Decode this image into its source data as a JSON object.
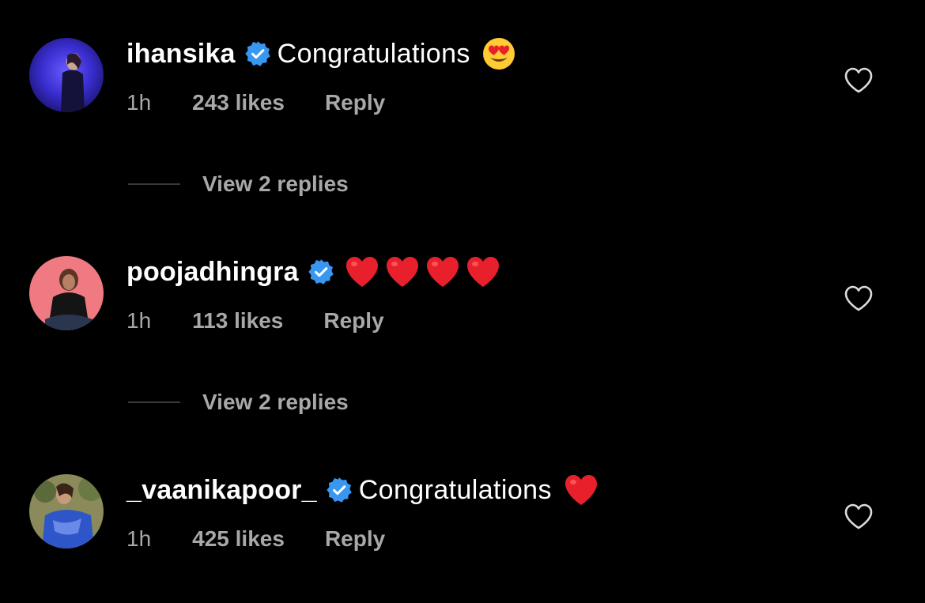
{
  "comments": [
    {
      "username": "ihansika",
      "verified": true,
      "text": "Congratulations",
      "emojis": [
        "heart-eyes-emoji"
      ],
      "time": "1h",
      "likes": "243 likes",
      "reply_label": "Reply",
      "liked": false,
      "view_replies": "View 2 replies"
    },
    {
      "username": "poojadhingra",
      "verified": true,
      "text": "",
      "emojis": [
        "red-heart-emoji",
        "red-heart-emoji",
        "red-heart-emoji",
        "red-heart-emoji"
      ],
      "time": "1h",
      "likes": "113 likes",
      "reply_label": "Reply",
      "liked": false,
      "view_replies": "View 2 replies"
    },
    {
      "username": "_vaanikapoor_",
      "verified": true,
      "text": "Congratulations",
      "emojis": [
        "red-heart-emoji"
      ],
      "time": "1h",
      "likes": "425 likes",
      "reply_label": "Reply",
      "liked": false
    }
  ],
  "colors": {
    "background": "#000000",
    "primary_text": "#ffffff",
    "secondary_text": "#a8a8a8",
    "verified_badge": "#3897f0",
    "divider": "#3a3a3a",
    "heart_emoji": "#e8202c"
  }
}
